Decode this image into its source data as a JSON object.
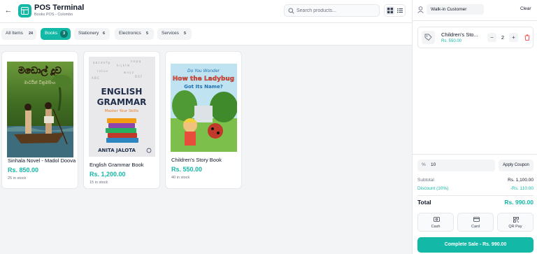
{
  "header": {
    "title": "POS Terminal",
    "subtitle": "Books POS - Colombo",
    "search_placeholder": "Search products..."
  },
  "categories": [
    {
      "label": "All Items",
      "count": "24",
      "active": false
    },
    {
      "label": "Books",
      "count": "3",
      "active": true
    },
    {
      "label": "Stationery",
      "count": "6",
      "active": false
    },
    {
      "label": "Electronics",
      "count": "5",
      "active": false
    },
    {
      "label": "Services",
      "count": "5",
      "active": false
    }
  ],
  "products": [
    {
      "name": "Sinhala Novel - Madol Doova",
      "price": "Rs. 850.00",
      "stock": "25 in stock",
      "cover_title": "මඩොල් දූව",
      "cover_sub": "මාර්ටින් වික්‍රමසිංහ"
    },
    {
      "name": "English Grammar Book",
      "price": "Rs. 1,200.00",
      "stock": "15 in stock",
      "cover_title_1": "ENGLISH",
      "cover_title_2": "GRAMMAR",
      "cover_tagline": "Master Your Skills",
      "cover_author": "ANITA JALOTA"
    },
    {
      "name": "Children's Story Book",
      "price": "Rs. 550.00",
      "stock": "40 in stock",
      "cover_line_1": "Do You Wonder",
      "cover_line_2": "How the Ladybug",
      "cover_line_3": "Got Its Name?"
    }
  ],
  "cart": {
    "customer": "Walk-in Customer",
    "clear_label": "Clear",
    "items": [
      {
        "name": "Children's Sto...",
        "price": "Rs. 550.00",
        "qty": "2"
      }
    ],
    "coupon_symbol": "%",
    "coupon_value": "10",
    "apply_label": "Apply Coupon",
    "subtotal_label": "Subtotal",
    "subtotal": "Rs. 1,100.00",
    "discount_label": "Discount (10%)",
    "discount": "-Rs. 110.00",
    "total_label": "Total",
    "total": "Rs. 990.00",
    "payment_methods": [
      "Cash",
      "Card",
      "QR Pay"
    ],
    "complete_label": "Complete Sale - Rs. 990.00"
  },
  "colors": {
    "accent": "#14b8a6",
    "danger": "#ef4444"
  }
}
